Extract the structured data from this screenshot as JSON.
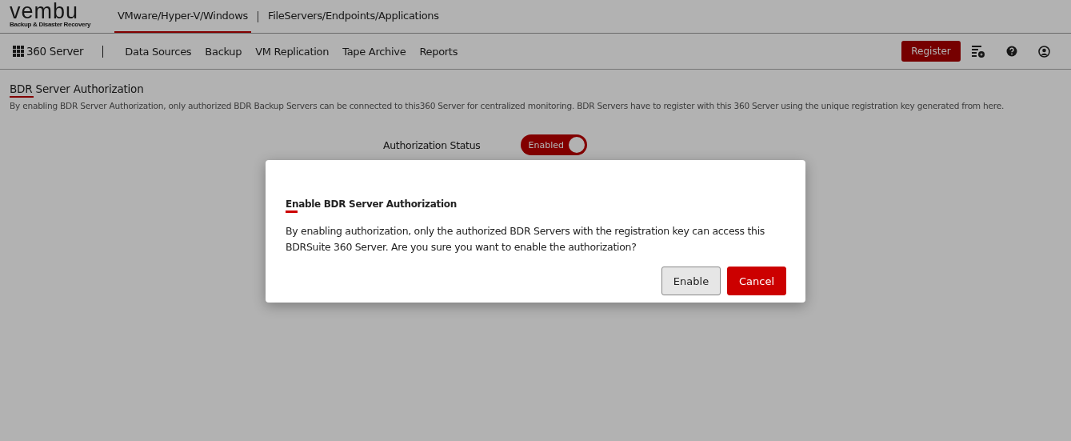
{
  "logo": {
    "name": "vembu",
    "tagline": "Backup & Disaster Recovery"
  },
  "product_tabs": [
    {
      "label": "VMware/Hyper-V/Windows",
      "selected": true
    },
    {
      "label": "FileServers/Endpoints/Applications",
      "selected": false
    }
  ],
  "nav": {
    "home": "360 Server",
    "items": [
      "Data Sources",
      "Backup",
      "VM Replication",
      "Tape Archive",
      "Reports"
    ],
    "register": "Register"
  },
  "page": {
    "title": "BDR Server Authorization",
    "description": "By enabling BDR Server Authorization, only authorized BDR Backup Servers can be connected to this360 Server for centralized monitoring. BDR Servers have to register with this 360 Server using the unique registration key generated from here.",
    "status_label": "Authorization Status",
    "toggle": {
      "label": "Enabled",
      "on": true
    }
  },
  "dialog": {
    "title": "Enable BDR Server Authorization",
    "message": "By enabling authorization, only the authorized BDR Servers with the registration key can access this BDRSuite 360 Server. Are you sure you want to enable the authorization?",
    "buttons": [
      {
        "label": "Enable",
        "kind": "secondary"
      },
      {
        "label": "Cancel",
        "kind": "primary"
      }
    ]
  }
}
